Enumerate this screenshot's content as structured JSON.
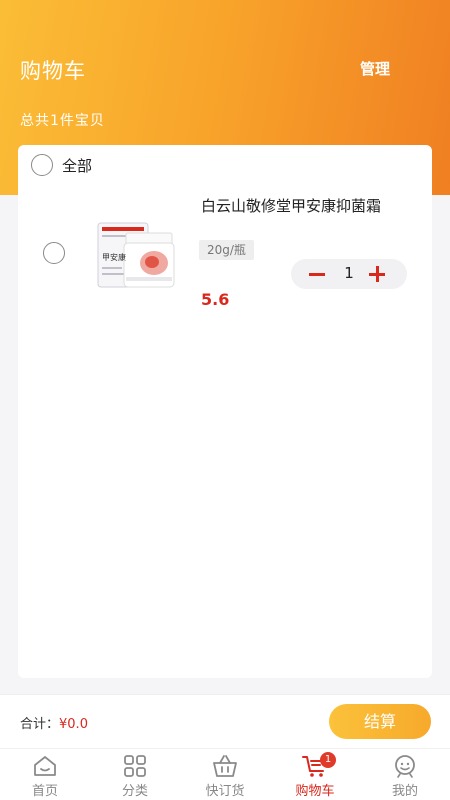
{
  "header": {
    "title": "购物车",
    "manage_label": "管理",
    "item_count": "总共1件宝贝"
  },
  "cart": {
    "select_all_label": "全部",
    "items": [
      {
        "name": "白云山敬修堂甲安康抑菌霜",
        "spec": "20g/瓶",
        "quantity": "1",
        "price": "5.6",
        "image_icon": "ointment-jar-product-image",
        "image_text": "甲安康"
      }
    ]
  },
  "footer": {
    "total_label": "合计：",
    "total_value": "¥0.0",
    "checkout_label": "结算"
  },
  "tabbar": {
    "tabs": [
      {
        "label": "首页",
        "icon": "home-icon"
      },
      {
        "label": "分类",
        "icon": "grid-icon"
      },
      {
        "label": "快订货",
        "icon": "basket-icon"
      },
      {
        "label": "购物车",
        "icon": "cart-icon",
        "active": true,
        "badge": "1"
      },
      {
        "label": "我的",
        "icon": "profile-icon"
      }
    ]
  },
  "colors": {
    "accent": "#d9281c",
    "header_gradient_start": "#fbbd36",
    "header_gradient_end": "#f07f22",
    "checkout_button": "#f8b030"
  }
}
